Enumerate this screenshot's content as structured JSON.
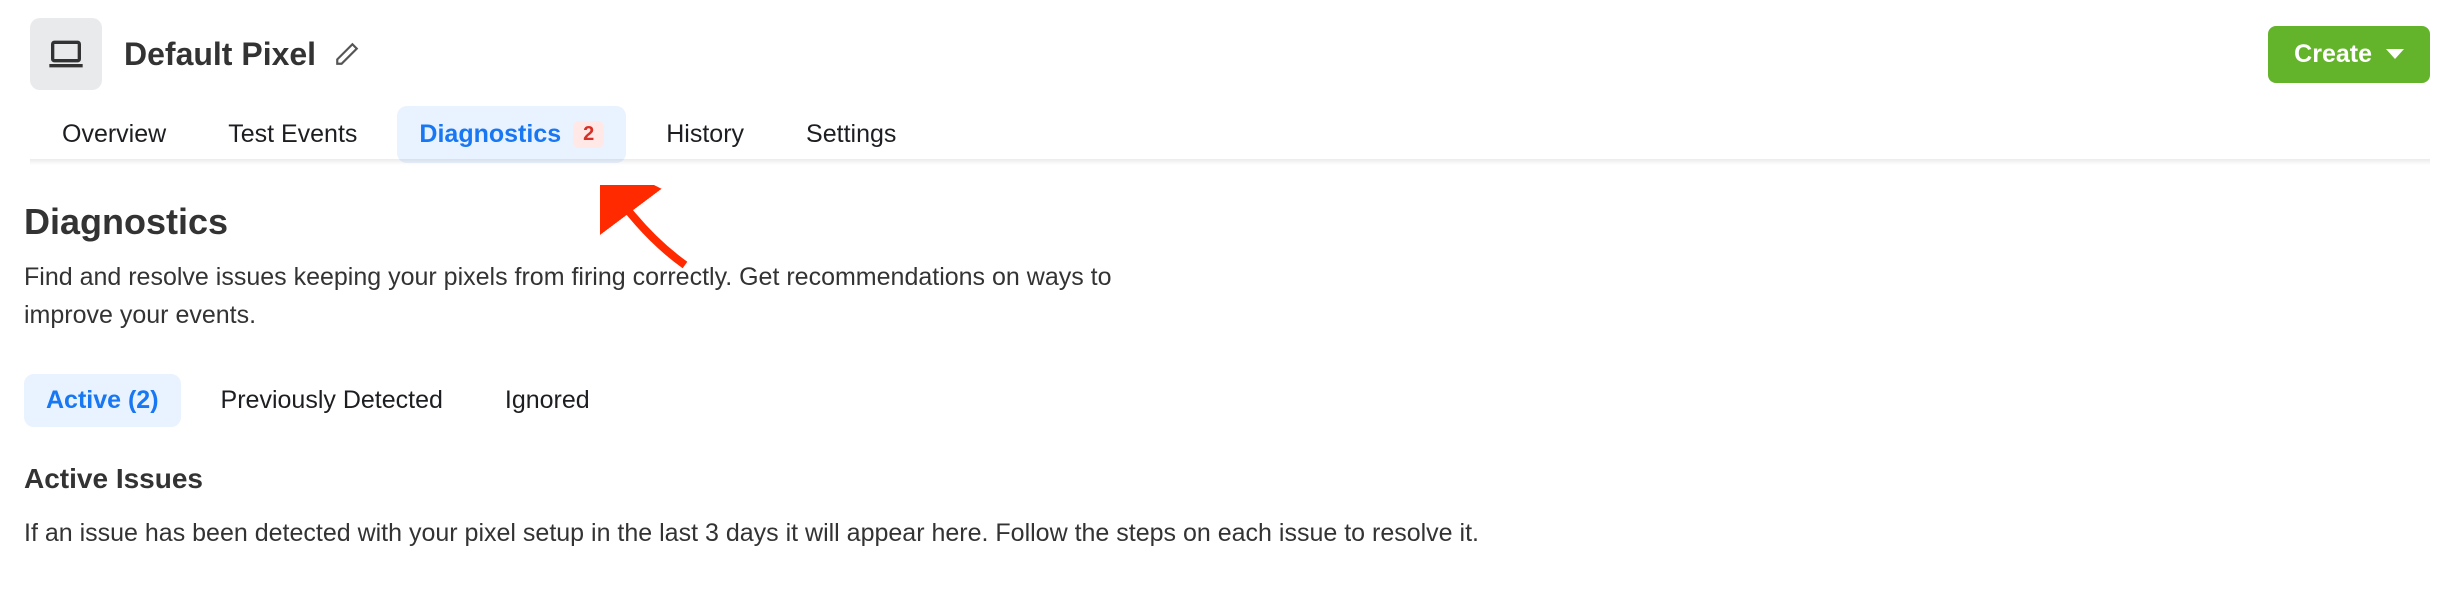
{
  "header": {
    "title": "Default Pixel",
    "create_label": "Create"
  },
  "tabs": [
    {
      "label": "Overview",
      "active": false
    },
    {
      "label": "Test Events",
      "active": false
    },
    {
      "label": "Diagnostics",
      "active": true,
      "badge": "2"
    },
    {
      "label": "History",
      "active": false
    },
    {
      "label": "Settings",
      "active": false
    }
  ],
  "main": {
    "heading": "Diagnostics",
    "description": "Find and resolve issues keeping your pixels from firing correctly. Get recommendations on ways to improve your events."
  },
  "subtabs": [
    {
      "label": "Active (2)",
      "active": true
    },
    {
      "label": "Previously Detected",
      "active": false
    },
    {
      "label": "Ignored",
      "active": false
    }
  ],
  "active_issues": {
    "heading": "Active Issues",
    "description": "If an issue has been detected with your pixel setup in the last 3 days it will appear here. Follow the steps on each issue to resolve it."
  },
  "colors": {
    "primary_blue": "#1877f2",
    "create_green": "#63b42a",
    "badge_red": "#d93025"
  }
}
